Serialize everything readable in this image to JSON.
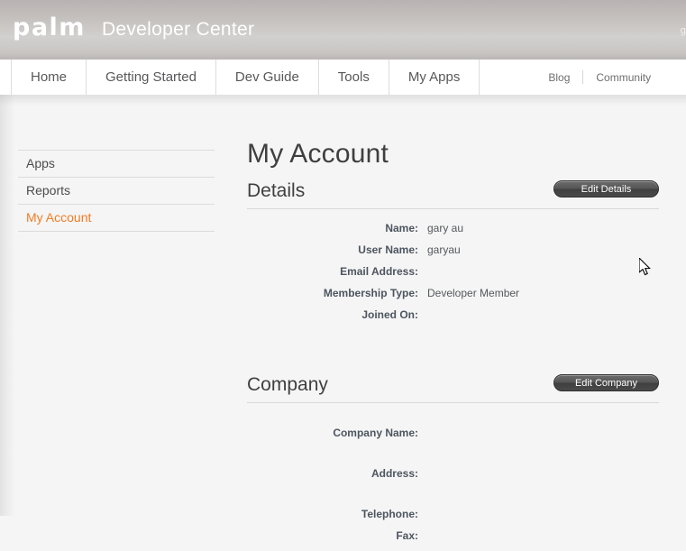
{
  "header": {
    "logo_text": "palm",
    "title": "Developer Center",
    "user_label": "ga"
  },
  "nav": {
    "main_items": [
      {
        "label": "Home",
        "name": "nav-item-home"
      },
      {
        "label": "Getting Started",
        "name": "nav-item-getting-started"
      },
      {
        "label": "Dev Guide",
        "name": "nav-item-dev-guide"
      },
      {
        "label": "Tools",
        "name": "nav-item-tools"
      },
      {
        "label": "My Apps",
        "name": "nav-item-my-apps"
      }
    ],
    "secondary_items": [
      {
        "label": "Blog",
        "name": "nav-link-blog"
      },
      {
        "label": "Community",
        "name": "nav-link-community"
      }
    ]
  },
  "sidebar": {
    "items": [
      {
        "label": "Apps",
        "active": false
      },
      {
        "label": "Reports",
        "active": false
      },
      {
        "label": "My Account",
        "active": true
      }
    ],
    "active_color": "#f07d23"
  },
  "main": {
    "page_title": "My Account",
    "details": {
      "section_title": "Details",
      "edit_button_label": "Edit Details",
      "fields": [
        {
          "label": "Name:",
          "value": "gary au"
        },
        {
          "label": "User Name:",
          "value": "garyau"
        },
        {
          "label": "Email Address:",
          "value": ""
        },
        {
          "label": "Membership Type:",
          "value": "Developer Member"
        },
        {
          "label": "Joined On:",
          "value": ""
        }
      ]
    },
    "company": {
      "section_title": "Company",
      "edit_button_label": "Edit Company",
      "fields": [
        {
          "label": "Company Name:",
          "value": ""
        },
        {
          "label": "Address:",
          "value": ""
        },
        {
          "label": "Telephone:",
          "value": ""
        },
        {
          "label": "Fax:",
          "value": ""
        }
      ]
    }
  }
}
